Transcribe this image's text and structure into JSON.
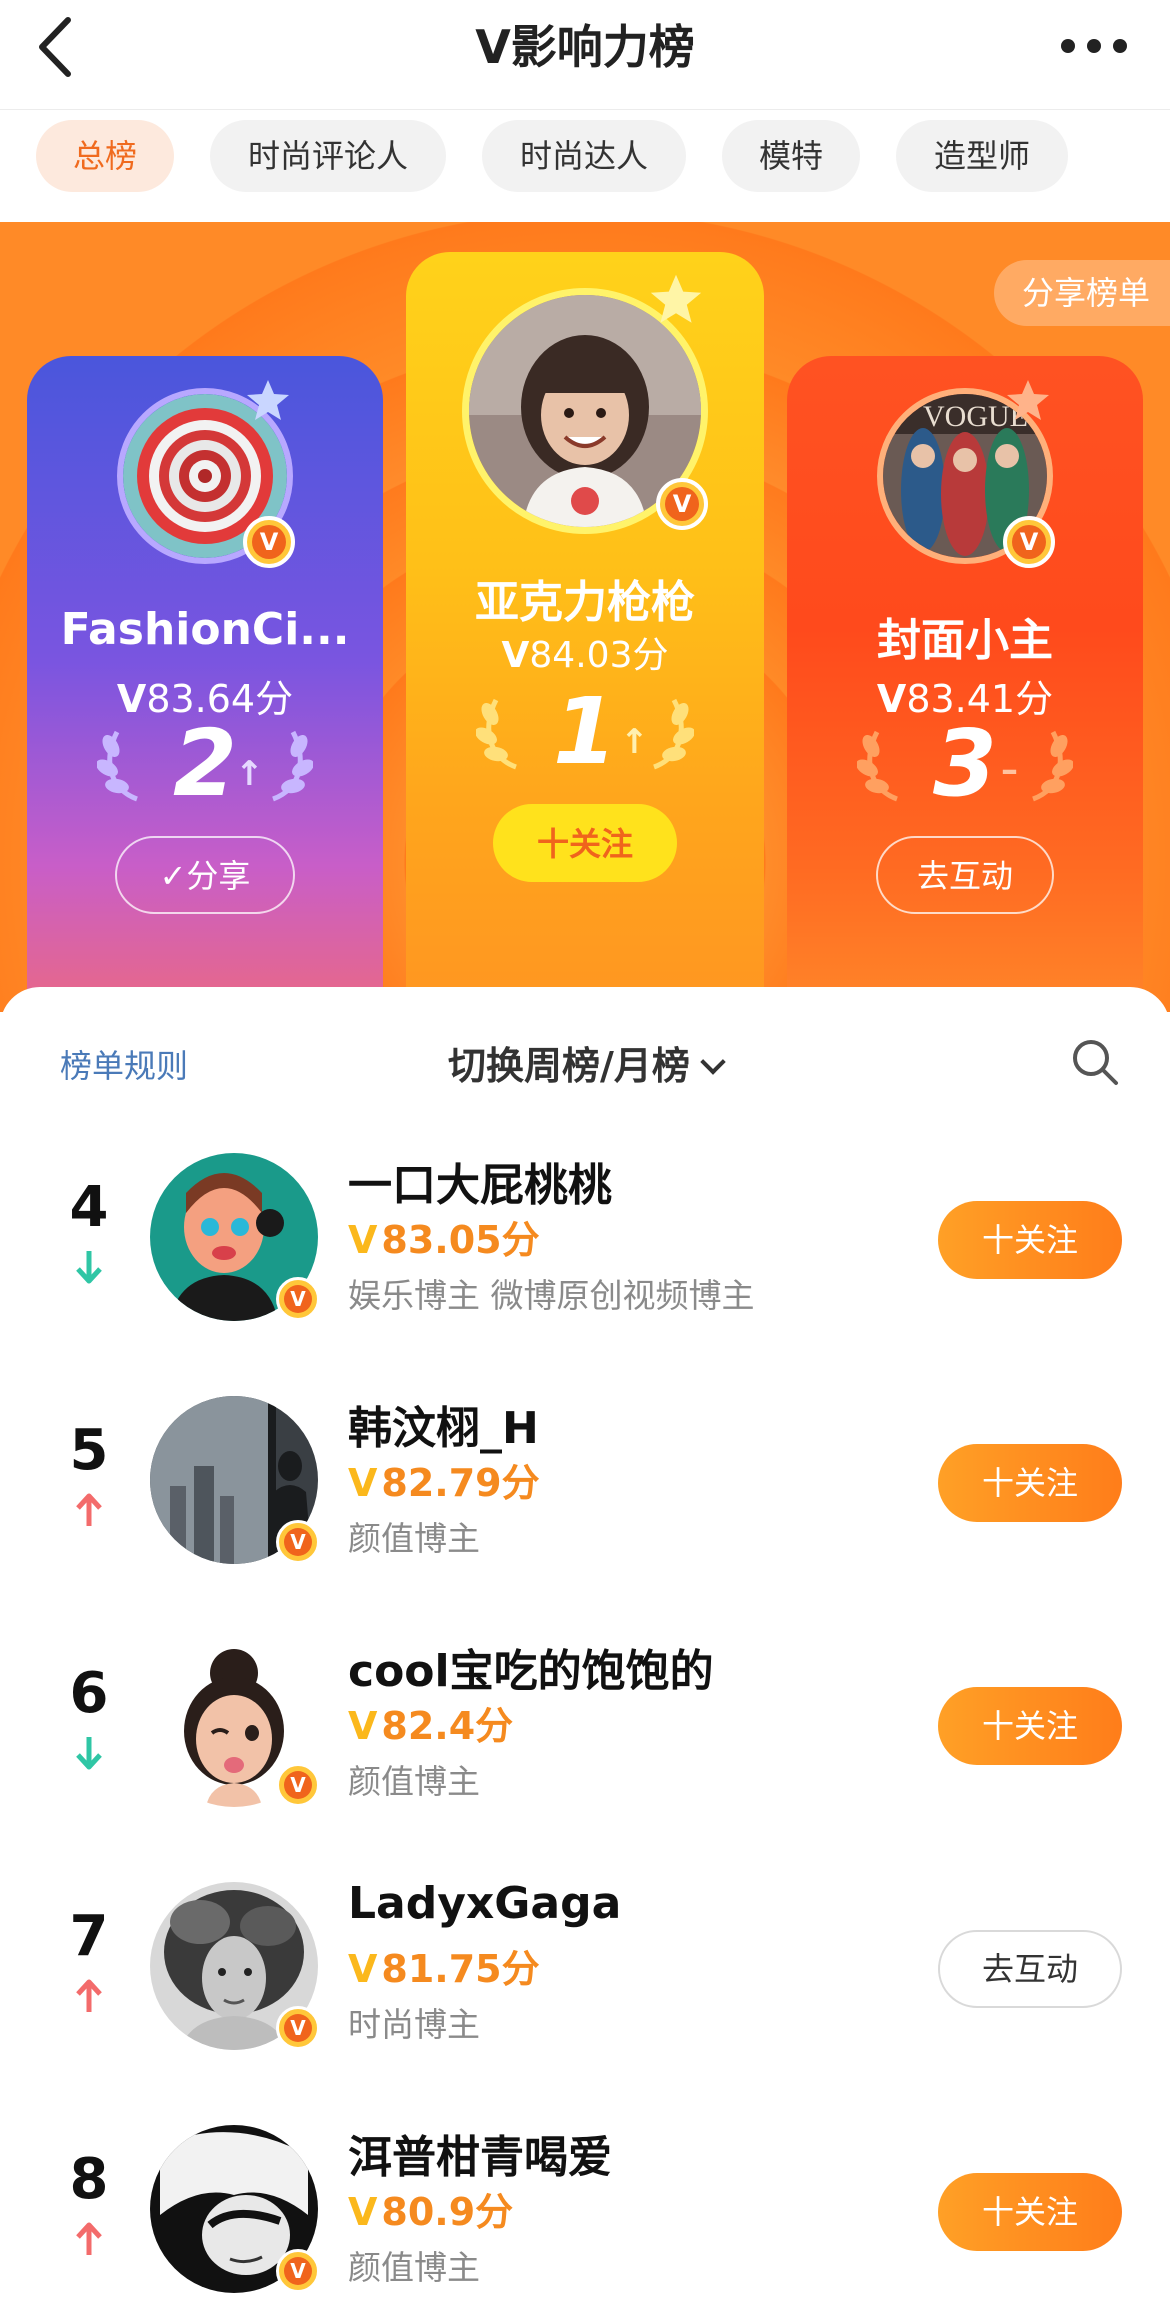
{
  "header": {
    "title": "V影响力榜"
  },
  "tabs": [
    {
      "label": "总榜",
      "active": true
    },
    {
      "label": "时尚评论人"
    },
    {
      "label": "时尚达人"
    },
    {
      "label": "模特"
    },
    {
      "label": "造型师"
    }
  ],
  "podium": {
    "share_label": "分享榜单",
    "first": {
      "name": "亚克力枪枪",
      "score": "84.03分",
      "rank": "1",
      "trend": "up",
      "button": "十关注"
    },
    "second": {
      "name": "FashionCi...",
      "score": "83.64分",
      "rank": "2",
      "trend": "up",
      "button": "分享"
    },
    "third": {
      "name": "封面小主",
      "score": "83.41分",
      "rank": "3",
      "trend": "same",
      "button": "去互动"
    }
  },
  "list_header": {
    "rules": "榜单规则",
    "switch": "切换周榜/月榜"
  },
  "list": [
    {
      "rank": "4",
      "trend": "down",
      "name": "一口大屁桃桃",
      "score": "83.05分",
      "tags": "娱乐博主 微博原创视频博主",
      "button": "十关注",
      "button_type": "follow"
    },
    {
      "rank": "5",
      "trend": "up",
      "name": "韩汶栩_H",
      "score": "82.79分",
      "tags": "颜值博主",
      "button": "十关注",
      "button_type": "follow"
    },
    {
      "rank": "6",
      "trend": "down",
      "name": "cool宝吃的饱饱的",
      "score": "82.4分",
      "tags": "颜值博主",
      "button": "十关注",
      "button_type": "follow"
    },
    {
      "rank": "7",
      "trend": "up",
      "name": "LadyxGaga",
      "score": "81.75分",
      "tags": "时尚博主",
      "button": "去互动",
      "button_type": "interact"
    },
    {
      "rank": "8",
      "trend": "up",
      "name": "洱普柑青喝爱",
      "score": "80.9分",
      "tags": "颜值博主",
      "button": "十关注",
      "button_type": "follow"
    }
  ],
  "colors": {
    "accent": "#f06a1e",
    "score": "#f58a1f",
    "up": "#f36b6b",
    "down": "#2fc6a5"
  }
}
